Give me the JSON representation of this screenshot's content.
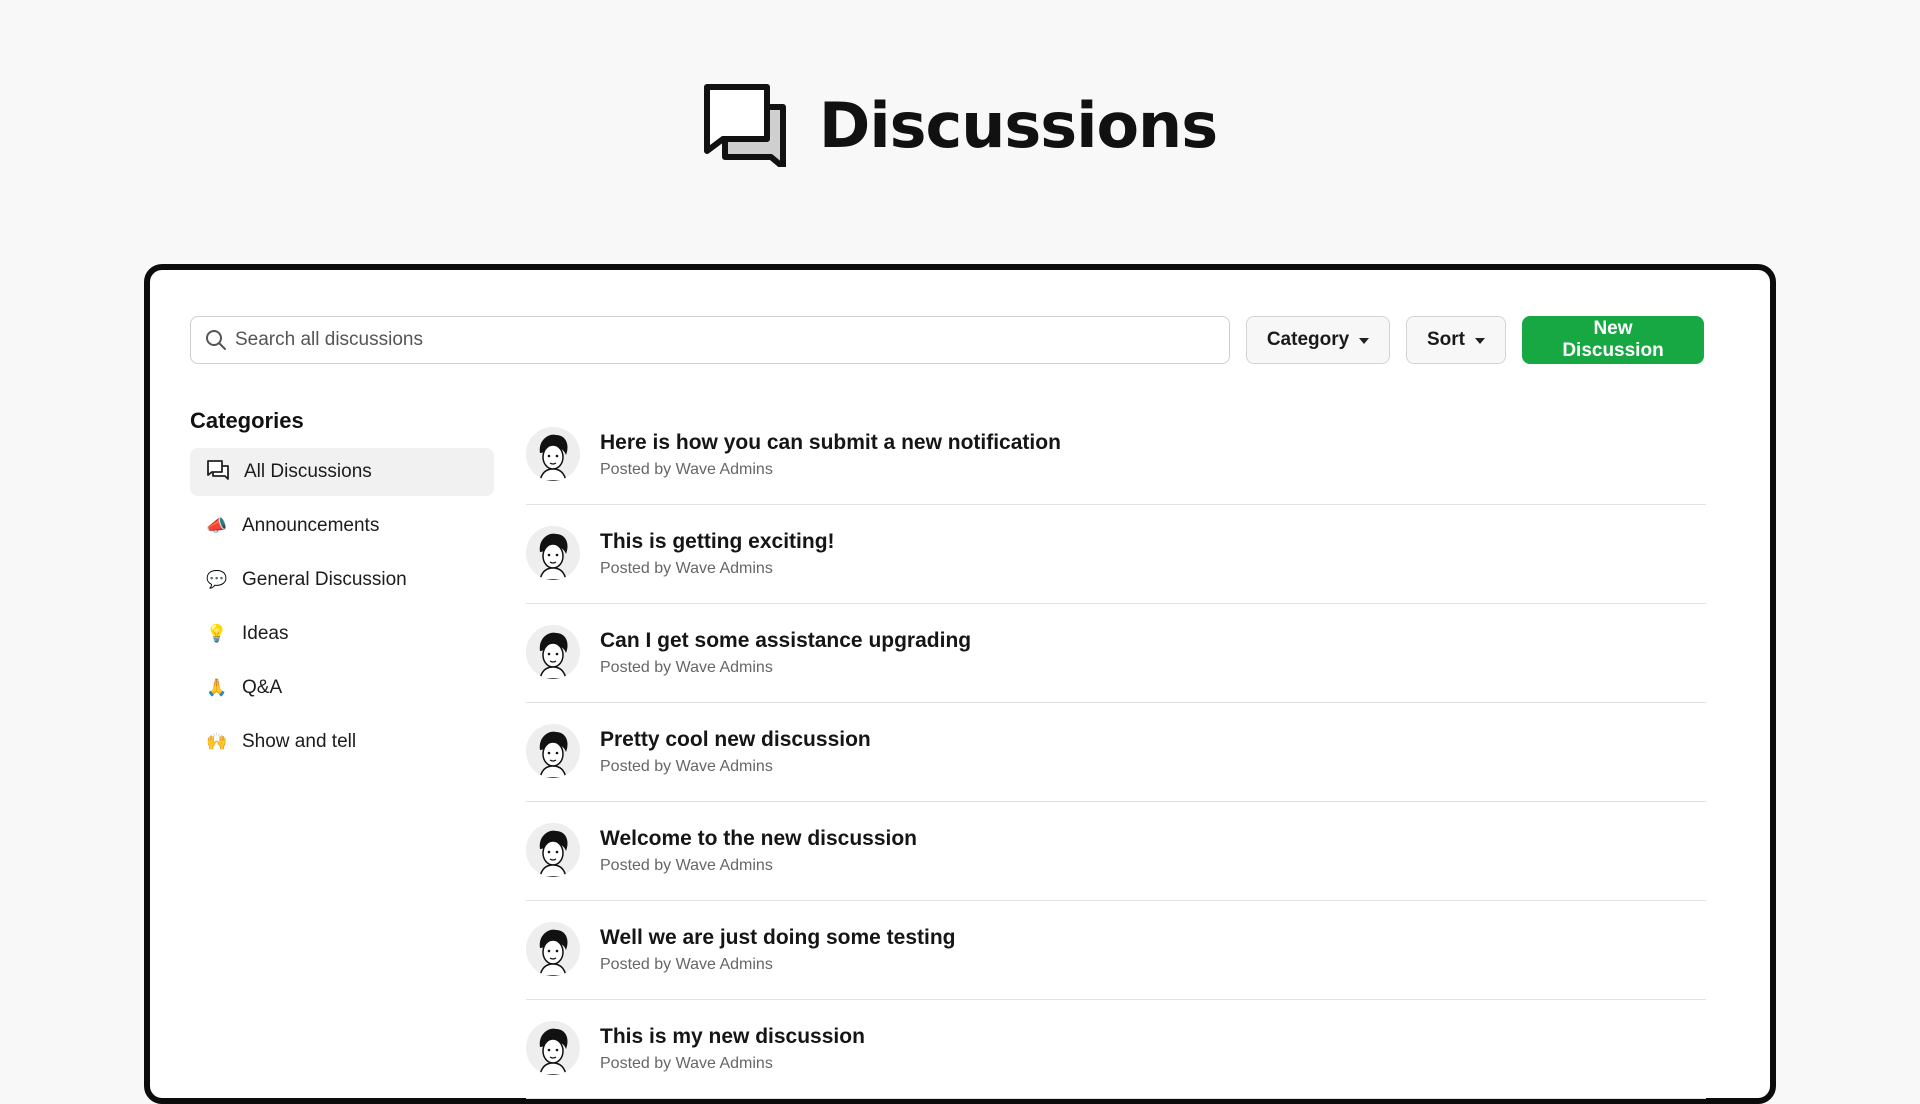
{
  "header": {
    "title": "Discussions",
    "icon": "chat-bubbles-icon"
  },
  "toolbar": {
    "search_placeholder": "Search all discussions",
    "search_value": "",
    "category_label": "Category",
    "sort_label": "Sort",
    "new_label": "New Discussion",
    "accent_color": "#18a843"
  },
  "sidebar": {
    "heading": "Categories",
    "items": [
      {
        "label": "All Discussions",
        "emoji": "chat-icon",
        "active": true
      },
      {
        "label": "Announcements",
        "emoji": "📣"
      },
      {
        "label": "General Discussion",
        "emoji": "💬"
      },
      {
        "label": "Ideas",
        "emoji": "💡"
      },
      {
        "label": "Q&A",
        "emoji": "🙏"
      },
      {
        "label": "Show and tell",
        "emoji": "🙌"
      }
    ]
  },
  "discussions": [
    {
      "title": "Here is how you can submit a new notification",
      "meta": "Posted by Wave Admins"
    },
    {
      "title": "This is getting exciting!",
      "meta": "Posted by Wave Admins"
    },
    {
      "title": "Can I get some assistance upgrading",
      "meta": "Posted by Wave Admins"
    },
    {
      "title": "Pretty cool new discussion",
      "meta": "Posted by Wave Admins"
    },
    {
      "title": "Welcome to the new discussion",
      "meta": "Posted by Wave Admins"
    },
    {
      "title": "Well we are just doing some testing",
      "meta": "Posted by Wave Admins"
    },
    {
      "title": "This is my new discussion",
      "meta": "Posted by Wave Admins"
    }
  ]
}
